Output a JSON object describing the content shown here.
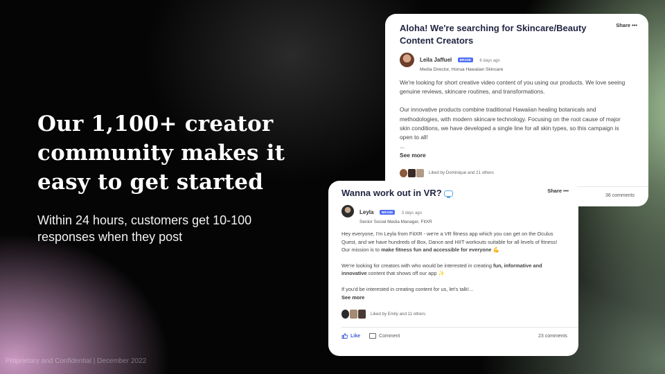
{
  "slide": {
    "headline": "Our 1,100+ creator community makes it easy to get started",
    "subhead": "Within 24 hours, customers get 10-100 responses when they post",
    "footer": "Proprietary and Confidential | December 2022"
  },
  "card1": {
    "share": "Share  •••",
    "title": "Aloha! We're searching for Skincare/Beauty Content Creators",
    "author": "Leila Jaffuel",
    "badge": "BRAND",
    "time": "6 days ago",
    "role": "Media Director, Honua Hawaiian Skincare",
    "p1": "We're looking for short creative video content of you using our products. We love seeing genuine reviews, skincare routines, and transformations.",
    "p2": "Our innovative products combine traditional Hawaiian healing botanicals and methodologies, with modern skincare technology. Focusing on the root cause of major skin conditions, we have developed a single line for all skin types, so this campaign is open to all!",
    "ellipsis": "...",
    "see_more": "See more",
    "liked_by": "Liked by Dominique and 21 others",
    "comments": "36 comments"
  },
  "card2": {
    "share": "Share  •••",
    "title": "Wanna work out in VR?",
    "author": "Leyla",
    "badge": "BRAND",
    "time": "3 days ago",
    "role": "Senior Social Media Manager, FitXR",
    "p1_text": "Hey everyone, I'm Leyla from FitXR - we're a VR fitness app which you can get on the Oculus Quest, and we have hundreds of Box, Dance and HIIT workouts suitable for all levels of fitness! Our mission is to ",
    "p1_bold": "make fitness fun and accessible for everyone",
    "p1_emoji": " 💪",
    "p2_text": "We're looking for creators with who would be interested in creating ",
    "p2_bold": " fun, informative and innovative",
    "p2_tail": " content that shows off our app ✨",
    "p3": "If you'd be interested in creating content for us, let's talk!...",
    "see_more": "See more",
    "liked_by": "Liked by Emily and 11 others",
    "like": "Like",
    "comment": "Comment",
    "comments": "23 comments"
  },
  "colors": {
    "accent": "#3a5bd9",
    "badge": "#4f6df5",
    "title": "#1f2340"
  },
  "icons": {
    "share_menu": "ellipsis-icon",
    "vr": "vr-headset-icon",
    "like": "thumbs-up-icon",
    "comment": "comment-icon"
  }
}
